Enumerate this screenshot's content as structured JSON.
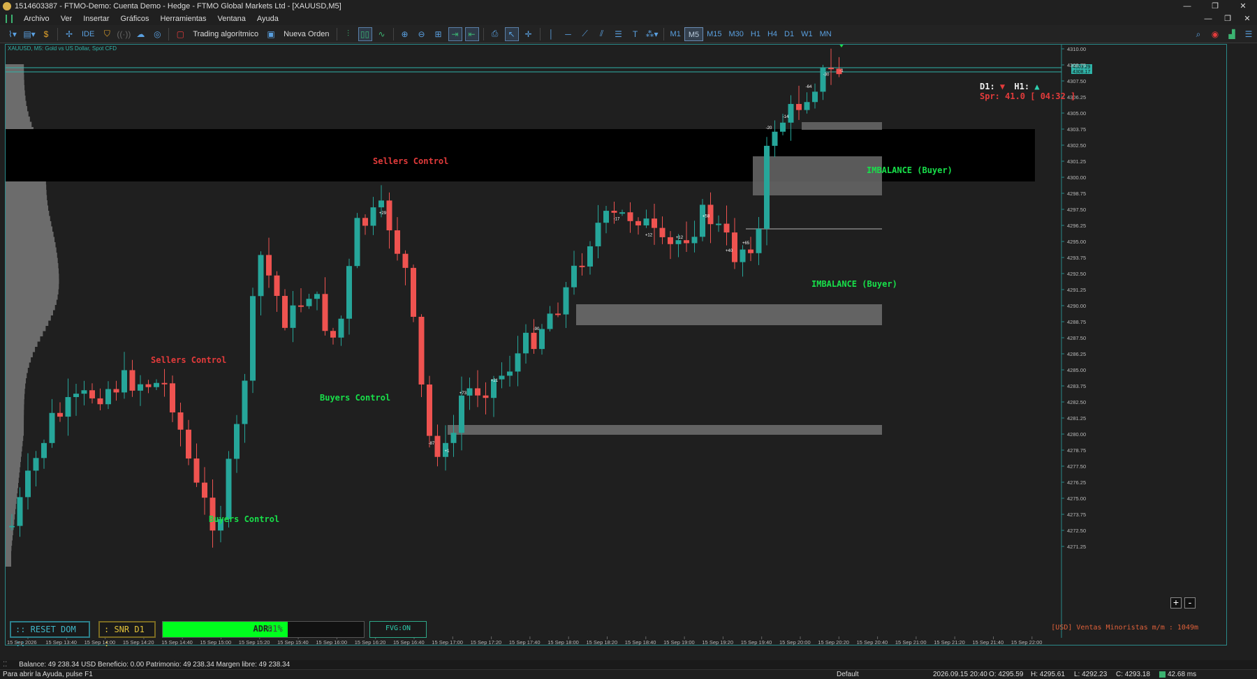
{
  "window": {
    "title": "1514603387 - FTMO-Demo: Cuenta Demo - Hedge - FTMO Global Markets Ltd - [XAUUSD,M5]",
    "controls": [
      "—",
      "❐",
      "✕"
    ]
  },
  "menu": {
    "items": [
      "Archivo",
      "Ver",
      "Insertar",
      "Gráficos",
      "Herramientas",
      "Ventana",
      "Ayuda"
    ],
    "mdi_controls": [
      "—",
      "❐",
      "✕"
    ]
  },
  "toolbar": {
    "ide_label": "IDE",
    "algo_label": "Trading algorítmico",
    "new_order_label": "Nueva Orden",
    "timeframes": [
      "M1",
      "M5",
      "M15",
      "M30",
      "H1",
      "H4",
      "D1",
      "W1",
      "MN"
    ],
    "active_timeframe": "M5"
  },
  "chart": {
    "symbol_label": "XAUUSD, M5:  Gold vs US Dollar, Spot CFD",
    "price_axis": [
      "4310.00",
      "4308.75",
      "4307.50",
      "4306.25",
      "4305.00",
      "4303.75",
      "4302.50",
      "4301.25",
      "4300.00",
      "4298.75",
      "4297.50",
      "4296.25",
      "4295.00",
      "4293.75",
      "4292.50",
      "4291.25",
      "4290.00",
      "4288.75",
      "4287.50",
      "4286.25",
      "4285.00",
      "4283.75",
      "4282.50",
      "4281.25",
      "4280.00",
      "4278.75",
      "4277.50",
      "4276.25",
      "4275.00",
      "4273.75",
      "4272.50",
      "4271.25"
    ],
    "current_bid": "4309.29",
    "current_ask": "4308.17",
    "time_axis": [
      "15 Sep 2026",
      "15 Sep 13:40",
      "15 Sep 14:00",
      "15 Sep 14:20",
      "15 Sep 14:40",
      "15 Sep 15:00",
      "15 Sep 15:20",
      "15 Sep 15:40",
      "15 Sep 16:00",
      "15 Sep 16:20",
      "15 Sep 16:40",
      "15 Sep 17:00",
      "15 Sep 17:20",
      "15 Sep 17:40",
      "15 Sep 18:00",
      "15 Sep 18:20",
      "15 Sep 18:40",
      "15 Sep 19:00",
      "15 Sep 19:20",
      "15 Sep 19:40",
      "15 Sep 20:00",
      "15 Sep 20:20",
      "15 Sep 20:40",
      "15 Sep 21:00",
      "15 Sep 21:20",
      "15 Sep 21:40",
      "15 Sep 22:00"
    ],
    "colors": {
      "bull": "#26a69a",
      "bear": "#ef5350",
      "zone": "#6a6a6a",
      "band": "#000000",
      "frame": "#2a8a8a"
    },
    "labels": {
      "sellers_1": "Sellers Control",
      "sellers_2": "Sellers Control",
      "buyers_1": "Buyers Control",
      "buyers_2": "Buyers Control",
      "imbalance_1": "IMBALANCE (Buyer)",
      "imbalance_2": "IMBALANCE (Buyer)"
    },
    "candle_deltas": [
      "+29",
      "-90",
      "+21",
      "+73",
      "-87",
      "+1",
      "-17",
      "+12",
      "+12",
      "+58",
      "+40",
      "+65",
      "-20",
      "-14",
      "-64",
      "-30",
      "-1"
    ],
    "info": {
      "d1_label": "D1:",
      "d1_arrow": "▼",
      "h1_label": "H1:",
      "h1_arrow": "▲",
      "spread": "Spr: 41.0 [ 04:32 ]"
    },
    "panel": {
      "reset_dom": ":: RESET DOM ::",
      "snr": ": SNR D1 :",
      "adr_label": "ADR:",
      "adr_pct": "81%",
      "adr_fill": 0.62,
      "fvg": "FVG:ON"
    },
    "zoom": {
      "plus": "+",
      "minus": "-"
    },
    "retail": "[USD] Ventas Minoristas m/m : 1049m"
  },
  "account_bar": "Balance: 49 238.34 USD  Beneficio: 0.00  Patrimonio: 49 238.34  Margen libre: 49 238.34",
  "status": {
    "help": "Para abrir la Ayuda, pulse F1",
    "profile": "Default",
    "datetime": "2026.09.15 20:40",
    "open": "O: 4295.59",
    "high": "H: 4295.61",
    "low": "L: 4292.23",
    "close": "C: 4293.18",
    "network": "42.68 ms"
  }
}
